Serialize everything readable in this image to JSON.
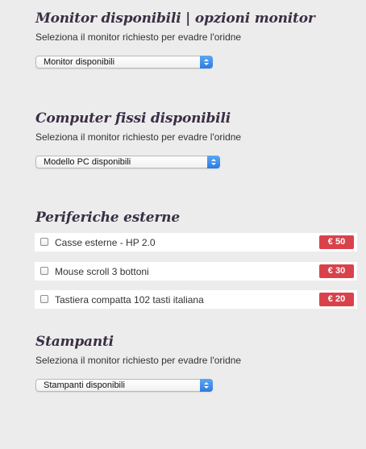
{
  "monitor_section": {
    "title": "Monitor disponibili | opzioni monitor",
    "description": "Seleziona il monitor richiesto per evadre l'oridne",
    "select_value": "Monitor disponibili"
  },
  "computer_section": {
    "title": "Computer fissi disponibili",
    "description": "Seleziona il monitor richiesto per evadre l'oridne",
    "select_value": "Modello PC disponibili"
  },
  "peripherals_section": {
    "title": "Periferiche esterne",
    "items": [
      {
        "label": "Casse esterne - HP 2.0",
        "price": "€ 50",
        "checked": false
      },
      {
        "label": "Mouse scroll 3 bottoni",
        "price": "€ 30",
        "checked": false
      },
      {
        "label": "Tastiera compatta 102 tasti italiana",
        "price": "€ 20",
        "checked": false
      }
    ]
  },
  "printers_section": {
    "title": "Stampanti",
    "description": "Seleziona il monitor richiesto per evadre l'oridne",
    "select_value": "Stampanti disponibili"
  },
  "colors": {
    "background": "#ececec",
    "title": "#3a2f45",
    "price_badge": "#d9424b",
    "select_arrow": "#2c7be0"
  }
}
